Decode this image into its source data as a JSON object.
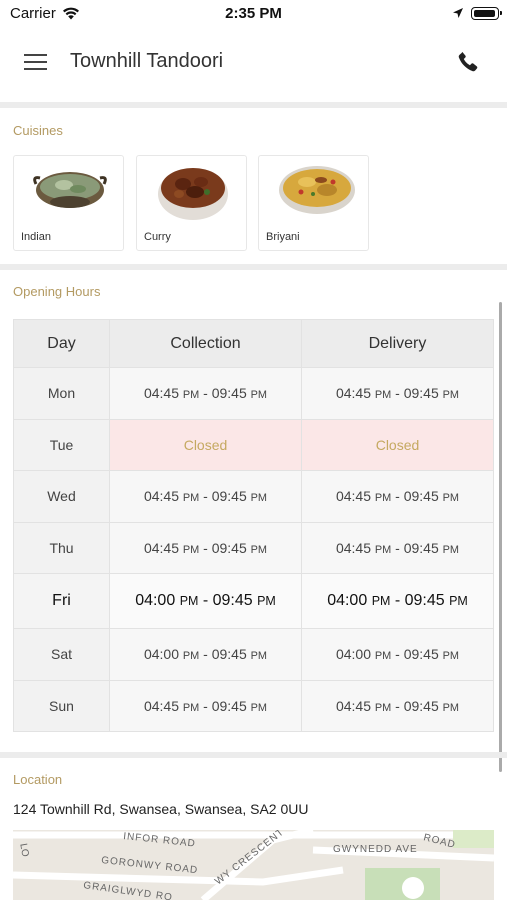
{
  "status_bar": {
    "carrier": "Carrier",
    "time": "2:35 PM"
  },
  "header": {
    "title": "Townhill Tandoori"
  },
  "cuisines": {
    "label": "Cuisines",
    "items": [
      {
        "name": "Indian"
      },
      {
        "name": "Curry"
      },
      {
        "name": "Briyani"
      }
    ]
  },
  "opening_hours": {
    "label": "Opening Hours",
    "headers": {
      "day": "Day",
      "collection": "Collection",
      "delivery": "Delivery"
    },
    "closed_text": "Closed",
    "rows": [
      {
        "day": "Mon",
        "collection": {
          "start": "04:45",
          "start_ampm": "PM",
          "sep": " - ",
          "end": "09:45",
          "end_ampm": "PM"
        },
        "delivery": {
          "start": "04:45",
          "start_ampm": "PM",
          "sep": " - ",
          "end": "09:45",
          "end_ampm": "PM"
        }
      },
      {
        "day": "Tue",
        "collection_closed": "Closed",
        "delivery_closed": "Closed"
      },
      {
        "day": "Wed",
        "collection": {
          "start": "04:45",
          "start_ampm": "PM",
          "sep": " - ",
          "end": "09:45",
          "end_ampm": "PM"
        },
        "delivery": {
          "start": "04:45",
          "start_ampm": "PM",
          "sep": " - ",
          "end": "09:45",
          "end_ampm": "PM"
        }
      },
      {
        "day": "Thu",
        "collection": {
          "start": "04:45",
          "start_ampm": "PM",
          "sep": " - ",
          "end": "09:45",
          "end_ampm": "PM"
        },
        "delivery": {
          "start": "04:45",
          "start_ampm": "PM",
          "sep": " - ",
          "end": "09:45",
          "end_ampm": "PM"
        }
      },
      {
        "day": "Fri",
        "collection": {
          "start": "04:00",
          "start_ampm": "PM",
          "sep": " - ",
          "end": "09:45",
          "end_ampm": "PM"
        },
        "delivery": {
          "start": "04:00",
          "start_ampm": "PM",
          "sep": " - ",
          "end": "09:45",
          "end_ampm": "PM"
        }
      },
      {
        "day": "Sat",
        "collection": {
          "start": "04:00",
          "start_ampm": "PM",
          "sep": " - ",
          "end": "09:45",
          "end_ampm": "PM"
        },
        "delivery": {
          "start": "04:00",
          "start_ampm": "PM",
          "sep": " - ",
          "end": "09:45",
          "end_ampm": "PM"
        }
      },
      {
        "day": "Sun",
        "collection": {
          "start": "04:45",
          "start_ampm": "PM",
          "sep": " - ",
          "end": "09:45",
          "end_ampm": "PM"
        },
        "delivery": {
          "start": "04:45",
          "start_ampm": "PM",
          "sep": " - ",
          "end": "09:45",
          "end_ampm": "PM"
        }
      }
    ]
  },
  "location": {
    "label": "Location",
    "address": "124 Townhill Rd, Swansea, Swansea, SA2 0UU",
    "map_labels": {
      "r1": "INFOR ROAD",
      "r2": "GORONWY ROAD",
      "r3": "WY CRESCENT",
      "r4": "GWYNEDD AVE",
      "r5": "GRAIGLWYD RO",
      "r6": "ROAD",
      "r7": "LO"
    }
  },
  "icons": {
    "menu": "hamburger-menu-icon",
    "phone": "phone-icon",
    "wifi": "wifi-icon",
    "location": "location-arrow-icon",
    "battery": "battery-icon"
  },
  "colors": {
    "accent": "#b39a62",
    "closed_bg": "#fbe7e7",
    "closed_text": "#c5a961",
    "divider": "#ececec"
  }
}
